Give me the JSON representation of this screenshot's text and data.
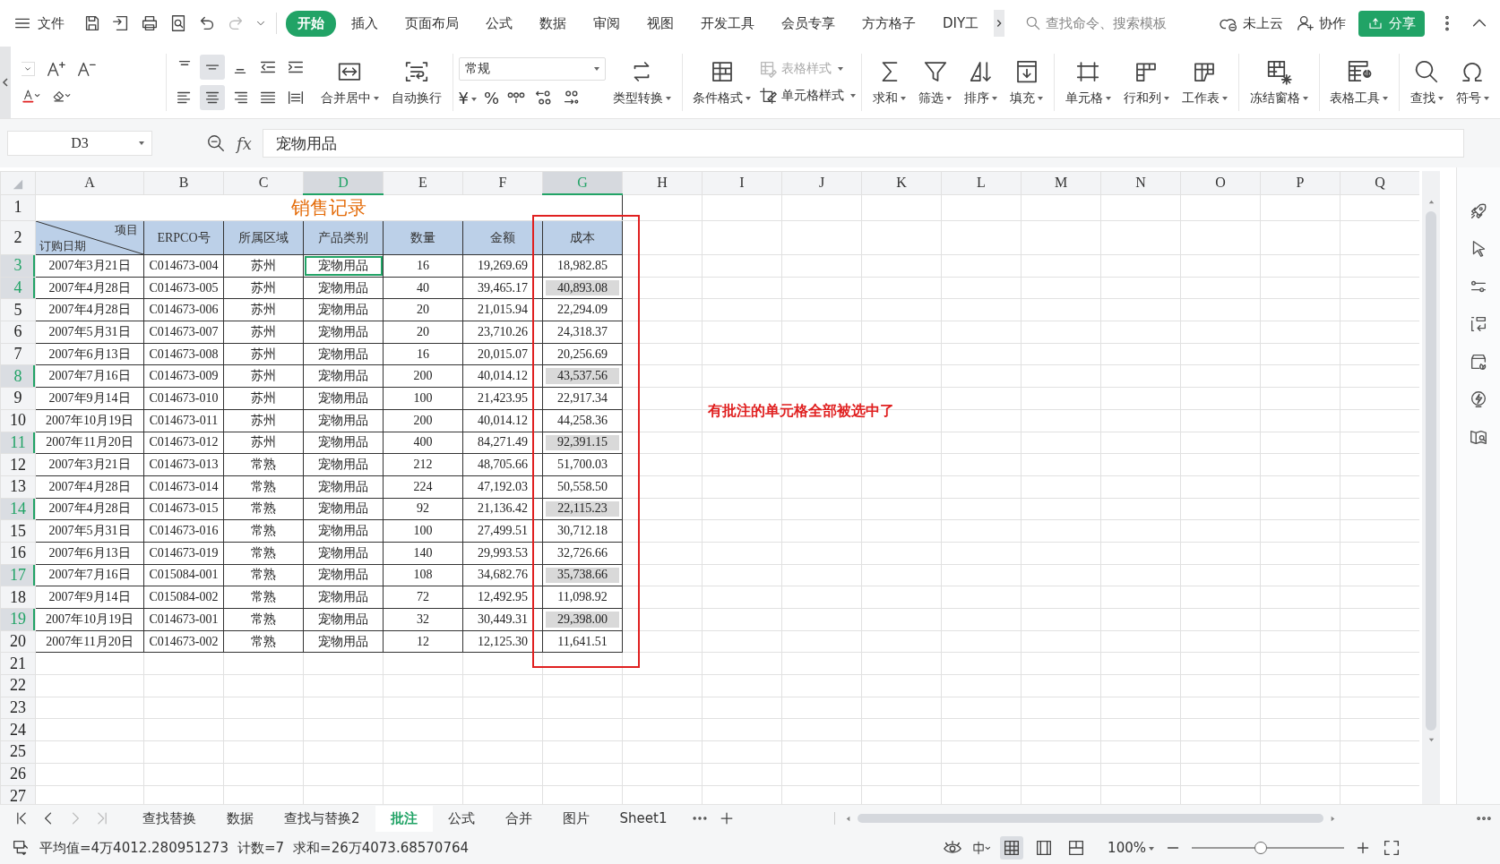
{
  "menu_bar": {
    "file_label": "文件",
    "tabs": [
      {
        "label": "开始",
        "selected": true
      },
      {
        "label": "插入",
        "selected": false
      },
      {
        "label": "页面布局",
        "selected": false
      },
      {
        "label": "公式",
        "selected": false
      },
      {
        "label": "数据",
        "selected": false
      },
      {
        "label": "审阅",
        "selected": false
      },
      {
        "label": "视图",
        "selected": false
      },
      {
        "label": "开发工具",
        "selected": false
      },
      {
        "label": "会员专享",
        "selected": false
      },
      {
        "label": "方方格子",
        "selected": false
      },
      {
        "label": "DIY工",
        "selected": false
      }
    ],
    "search_placeholder": "查找命令、搜索模板",
    "cloud_label": "未上云",
    "collab_label": "协作",
    "share_label": "分享"
  },
  "ribbon": {
    "align_tools": [
      {
        "kind": "top",
        "selected": false
      },
      {
        "kind": "middle",
        "selected": true
      },
      {
        "kind": "bottom",
        "selected": false
      },
      {
        "kind": "outdent",
        "selected": false
      },
      {
        "kind": "indent",
        "selected": false
      },
      {
        "kind": "left",
        "selected": false
      },
      {
        "kind": "center",
        "selected": true
      },
      {
        "kind": "right",
        "selected": false
      },
      {
        "kind": "justify",
        "selected": false
      },
      {
        "kind": "distributed",
        "selected": false
      }
    ],
    "align_buttons": [
      {
        "label": "合并居中",
        "kind": "merge",
        "dropdown": true
      },
      {
        "label": "自动换行",
        "kind": "wrap",
        "dropdown": false
      }
    ],
    "number_format": "常规",
    "currency": "¥",
    "percent": "%",
    "convert_button": {
      "label": "类型转换",
      "kind": "convert",
      "dropdown": true
    },
    "cond_button": {
      "label": "条件格式",
      "kind": "condfmt",
      "dropdown": true
    },
    "table_style": {
      "label": "表格样式",
      "disabled": true
    },
    "cell_style": {
      "label": "单元格样式",
      "disabled": false
    },
    "groups": [
      [
        {
          "label": "求和",
          "kind": "sum",
          "dropdown": true
        },
        {
          "label": "筛选",
          "kind": "filter",
          "dropdown": true
        },
        {
          "label": "排序",
          "kind": "sort",
          "dropdown": true
        },
        {
          "label": "填充",
          "kind": "fill",
          "dropdown": true
        }
      ],
      [
        {
          "label": "单元格",
          "kind": "cell",
          "dropdown": true
        },
        {
          "label": "行和列",
          "kind": "rowcol",
          "dropdown": true
        },
        {
          "label": "工作表",
          "kind": "sheet",
          "dropdown": true
        }
      ],
      [
        {
          "label": "冻结窗格",
          "kind": "freeze",
          "dropdown": true
        }
      ],
      [
        {
          "label": "表格工具",
          "kind": "tabletool",
          "dropdown": true
        }
      ],
      [
        {
          "label": "查找",
          "kind": "find",
          "dropdown": true
        },
        {
          "label": "符号",
          "kind": "symbol",
          "dropdown": true
        }
      ]
    ]
  },
  "formula_bar": {
    "name_box": "D3",
    "fx": "fx",
    "value": "宠物用品"
  },
  "sheet": {
    "columns": [
      {
        "label": "A",
        "selected": false
      },
      {
        "label": "B",
        "selected": false
      },
      {
        "label": "C",
        "selected": false
      },
      {
        "label": "D",
        "selected": true
      },
      {
        "label": "E",
        "selected": false
      },
      {
        "label": "F",
        "selected": false
      },
      {
        "label": "G",
        "selected": true
      },
      {
        "label": "H",
        "selected": false
      },
      {
        "label": "I",
        "selected": false
      },
      {
        "label": "J",
        "selected": false
      },
      {
        "label": "K",
        "selected": false
      },
      {
        "label": "L",
        "selected": false
      },
      {
        "label": "M",
        "selected": false
      },
      {
        "label": "N",
        "selected": false
      },
      {
        "label": "O",
        "selected": false
      },
      {
        "label": "P",
        "selected": false
      },
      {
        "label": "Q",
        "selected": false
      }
    ],
    "title_row": {
      "number": "1",
      "selected": false,
      "title": "销售记录"
    },
    "header_row": {
      "number": "2",
      "selected": false,
      "corner_top": "项目",
      "corner_bottom": "订购日期",
      "labels": [
        "ERPCO号",
        "所属区域",
        "产品类别",
        "数量",
        "金额",
        "成本"
      ]
    },
    "rows": [
      {
        "number": "3",
        "selected": true,
        "cells": [
          "2007年3月21日",
          "C014673-004",
          "苏州",
          {
            "text": "宠物用品",
            "active": true,
            "shaded": false
          },
          "16",
          "19,269.69",
          "18,982.85"
        ]
      },
      {
        "number": "4",
        "selected": true,
        "cells": [
          "2007年4月28日",
          "C014673-005",
          "苏州",
          "宠物用品",
          "40",
          "39,465.17",
          {
            "text": "40,893.08",
            "active": false,
            "shaded": true
          }
        ]
      },
      {
        "number": "5",
        "selected": false,
        "cells": [
          "2007年4月28日",
          "C014673-006",
          "苏州",
          "宠物用品",
          "20",
          "21,015.94",
          "22,294.09"
        ]
      },
      {
        "number": "6",
        "selected": false,
        "cells": [
          "2007年5月31日",
          "C014673-007",
          "苏州",
          "宠物用品",
          "20",
          "23,710.26",
          "24,318.37"
        ]
      },
      {
        "number": "7",
        "selected": false,
        "cells": [
          "2007年6月13日",
          "C014673-008",
          "苏州",
          "宠物用品",
          "16",
          "20,015.07",
          "20,256.69"
        ]
      },
      {
        "number": "8",
        "selected": true,
        "cells": [
          "2007年7月16日",
          "C014673-009",
          "苏州",
          "宠物用品",
          "200",
          "40,014.12",
          {
            "text": "43,537.56",
            "active": false,
            "shaded": true
          }
        ]
      },
      {
        "number": "9",
        "selected": false,
        "cells": [
          "2007年9月14日",
          "C014673-010",
          "苏州",
          "宠物用品",
          "100",
          "21,423.95",
          "22,917.34"
        ]
      },
      {
        "number": "10",
        "selected": false,
        "cells": [
          "2007年10月19日",
          "C014673-011",
          "苏州",
          "宠物用品",
          "200",
          "40,014.12",
          "44,258.36"
        ]
      },
      {
        "number": "11",
        "selected": true,
        "cells": [
          "2007年11月20日",
          "C014673-012",
          "苏州",
          "宠物用品",
          "400",
          "84,271.49",
          {
            "text": "92,391.15",
            "active": false,
            "shaded": true
          }
        ]
      },
      {
        "number": "12",
        "selected": false,
        "cells": [
          "2007年3月21日",
          "C014673-013",
          "常熟",
          "宠物用品",
          "212",
          "48,705.66",
          "51,700.03"
        ]
      },
      {
        "number": "13",
        "selected": false,
        "cells": [
          "2007年4月28日",
          "C014673-014",
          "常熟",
          "宠物用品",
          "224",
          "47,192.03",
          "50,558.50"
        ]
      },
      {
        "number": "14",
        "selected": true,
        "cells": [
          "2007年4月28日",
          "C014673-015",
          "常熟",
          "宠物用品",
          "92",
          "21,136.42",
          {
            "text": "22,115.23",
            "active": false,
            "shaded": true
          }
        ]
      },
      {
        "number": "15",
        "selected": false,
        "cells": [
          "2007年5月31日",
          "C014673-016",
          "常熟",
          "宠物用品",
          "100",
          "27,499.51",
          "30,712.18"
        ]
      },
      {
        "number": "16",
        "selected": false,
        "cells": [
          "2007年6月13日",
          "C014673-019",
          "常熟",
          "宠物用品",
          "140",
          "29,993.53",
          "32,726.66"
        ]
      },
      {
        "number": "17",
        "selected": true,
        "cells": [
          "2007年7月16日",
          "C015084-001",
          "常熟",
          "宠物用品",
          "108",
          "34,682.76",
          {
            "text": "35,738.66",
            "active": false,
            "shaded": true
          }
        ]
      },
      {
        "number": "18",
        "selected": false,
        "cells": [
          "2007年9月14日",
          "C015084-002",
          "常熟",
          "宠物用品",
          "72",
          "12,492.95",
          "11,098.92"
        ]
      },
      {
        "number": "19",
        "selected": true,
        "cells": [
          "2007年10月19日",
          "C014673-001",
          "常熟",
          "宠物用品",
          "32",
          "30,449.31",
          {
            "text": "29,398.00",
            "active": false,
            "shaded": true
          }
        ]
      },
      {
        "number": "20",
        "selected": false,
        "cells": [
          "2007年11月20日",
          "C014673-002",
          "常熟",
          "宠物用品",
          "12",
          "12,125.30",
          "11,641.51"
        ]
      }
    ],
    "empty_rows": [
      "21",
      "22",
      "23",
      "24",
      "25",
      "26",
      "27"
    ],
    "annotation": "有批注的单元格全部被选中了"
  },
  "sheet_tabs": [
    {
      "label": "查找替换",
      "selected": false
    },
    {
      "label": "数据",
      "selected": false
    },
    {
      "label": "查找与替换2",
      "selected": false
    },
    {
      "label": "批注",
      "selected": true
    },
    {
      "label": "公式",
      "selected": false
    },
    {
      "label": "合并",
      "selected": false
    },
    {
      "label": "图片",
      "selected": false
    },
    {
      "label": "Sheet1",
      "selected": false
    }
  ],
  "status_bar": {
    "average": "平均值=4万4012.280951273",
    "count": "计数=7",
    "sum": "求和=26万4073.68570764",
    "zoom": "100%",
    "zoom_level": {
      "level": 0.45
    }
  }
}
